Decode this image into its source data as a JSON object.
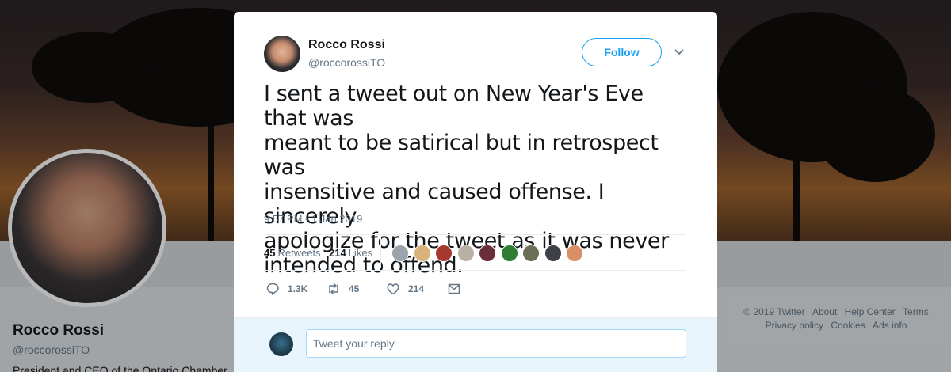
{
  "profile": {
    "name": "Rocco Rossi",
    "handle": "@roccorossiTO",
    "bio_partial": "President and CEO of the Ontario Chamber"
  },
  "footer": {
    "row1": [
      "© 2019 Twitter",
      "About",
      "Help Center",
      "Terms"
    ],
    "row2": [
      "Privacy policy",
      "Cookies",
      "Ads info"
    ]
  },
  "tweet": {
    "author_name": "Rocco Rossi",
    "author_handle": "@roccorossiTO",
    "follow_label": "Follow",
    "text": "I sent a tweet out on New Year's Eve that was\nmeant to be satirical but in retrospect was\ninsensitive and caused offense.  I sincerely\napologize for the tweet as it was never\nintended to offend.",
    "timestamp": "9:57 PM - 1 Jan 2019",
    "retweets_count": "45",
    "retweets_label": "Retweets",
    "likes_count": "214",
    "likes_label": "Likes",
    "likers": [
      "#9aa4ad",
      "#d9b27a",
      "#a6382f",
      "#b8b0a5",
      "#6a2d3a",
      "#2e7d32",
      "#6b6f57",
      "#3d4147",
      "#d99066"
    ],
    "actions": {
      "replies": "1.3K",
      "retweets": "45",
      "likes": "214"
    }
  },
  "reply": {
    "placeholder": "Tweet your reply"
  },
  "colors": {
    "accent": "#1da1f2",
    "text": "#14171a",
    "secondary": "#657786"
  }
}
